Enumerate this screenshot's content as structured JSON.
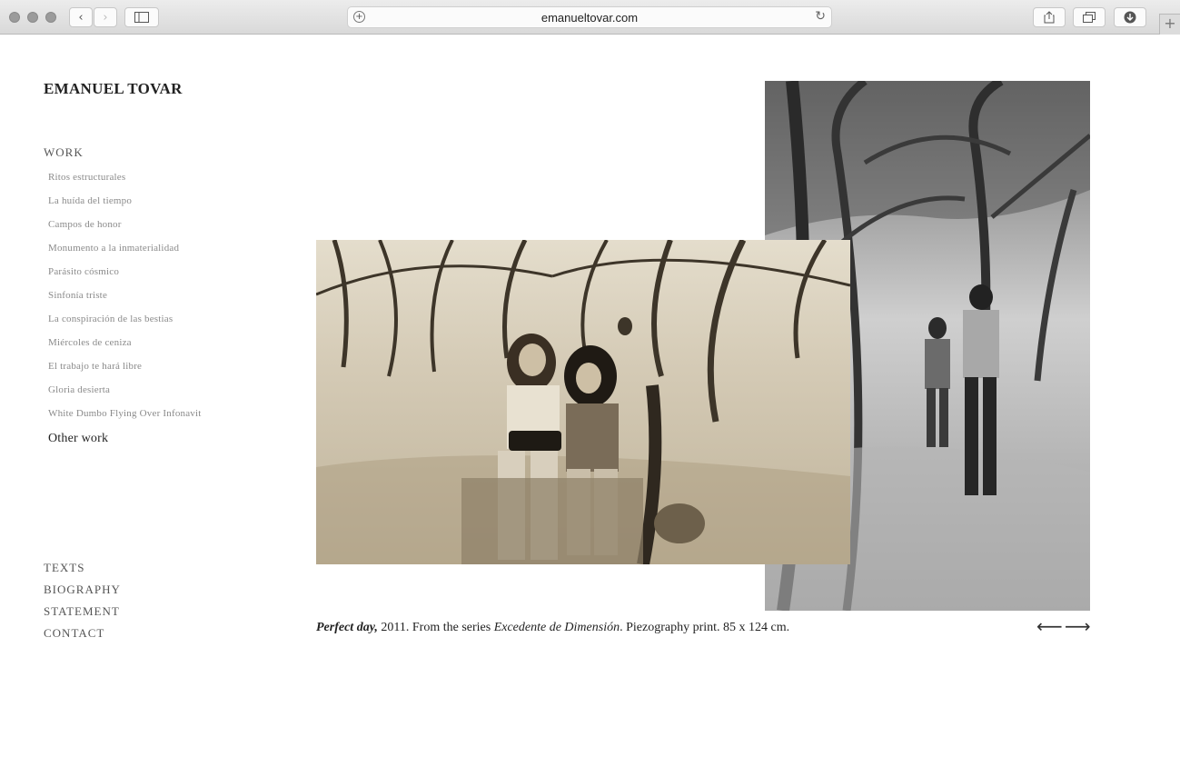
{
  "browser": {
    "url": "emanueltovar.com",
    "back_glyph": "‹",
    "forward_glyph": "›",
    "new_tab_glyph": "+"
  },
  "site": {
    "title": "EMANUEL TOVAR"
  },
  "nav": {
    "work_label": "WORK",
    "work_items": [
      "Ritos estructurales",
      "La huída del tiempo",
      "Campos de honor",
      "Monumento a la inmaterialidad",
      "Parásito cósmico",
      "Sinfonía triste",
      "La conspiración de las bestias",
      "Miércoles de ceniza",
      "El trabajo te hará libre",
      "Gloria desierta",
      "White Dumbo Flying Over Infonavit",
      "Other work"
    ],
    "active_item": "Other work",
    "bottom": [
      "TEXTS",
      "BIOGRAPHY",
      "STATEMENT",
      "CONTACT"
    ]
  },
  "caption": {
    "title": "Perfect day,",
    "year": " 2011. From the series ",
    "series": "Excedente de Dimensión",
    "details": ". Piezography print. 85 x 124 cm."
  },
  "pager": {
    "prev": "⟵",
    "next": "⟶"
  },
  "colors": {
    "sepia_light": "#e6dfcf",
    "sepia_dark": "#3a3428",
    "bw_light": "#d8d8d8",
    "bw_dark": "#2a2a2a"
  }
}
